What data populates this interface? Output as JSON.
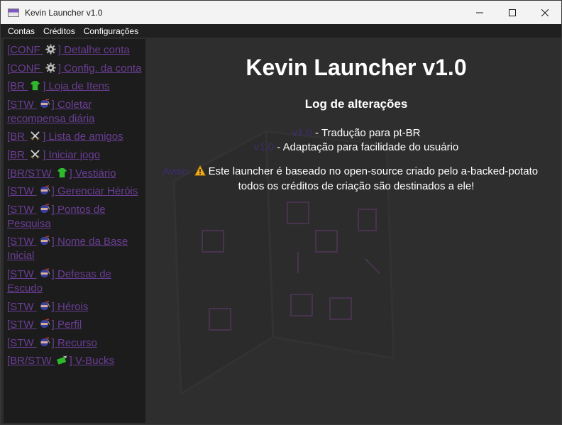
{
  "window": {
    "title": "Kevin Launcher v1.0"
  },
  "menu": {
    "items": [
      "Contas",
      "Créditos",
      "Configurações"
    ]
  },
  "sidebar": {
    "items": [
      {
        "prefix": "[CONF",
        "icon": "gear-icon",
        "label": "] Detalhe conta"
      },
      {
        "prefix": "[CONF",
        "icon": "gear-icon",
        "label": "] Config. da conta"
      },
      {
        "prefix": "[BR",
        "icon": "shirt-icon",
        "label": "] Loja de Itens"
      },
      {
        "prefix": "[STW",
        "icon": "ninja-icon",
        "label": "] Coletar recompensa diária"
      },
      {
        "prefix": "[BR",
        "icon": "crossed-swords-icon",
        "label": "] Lista de amigos"
      },
      {
        "prefix": "[BR",
        "icon": "crossed-swords-icon",
        "label": "] Iniciar jogo"
      },
      {
        "prefix": "[BR/STW",
        "icon": "shirt-icon",
        "label": "] Vestiário"
      },
      {
        "prefix": "[STW",
        "icon": "ninja-icon",
        "label": "] Gerenciar Héróis"
      },
      {
        "prefix": "[STW",
        "icon": "ninja-icon",
        "label": "] Pontos de Pesquisa"
      },
      {
        "prefix": "[STW",
        "icon": "ninja-icon",
        "label": "] Nome da Base Inicial"
      },
      {
        "prefix": "[STW",
        "icon": "ninja-icon",
        "label": "] Defesas de Escudo"
      },
      {
        "prefix": "[STW",
        "icon": "ninja-icon",
        "label": "] Hérois"
      },
      {
        "prefix": "[STW",
        "icon": "ninja-icon",
        "label": "] Perfil"
      },
      {
        "prefix": "[STW",
        "icon": "ninja-icon",
        "label": "] Recurso"
      },
      {
        "prefix": "[BR/STW",
        "icon": "money-icon",
        "label": "] V-Bucks"
      }
    ]
  },
  "main": {
    "title": "Kevin Launcher v1.0",
    "changelog_title": "Log de alterações",
    "changes": [
      {
        "version": "v1.0",
        "text": " - Tradução para pt-BR"
      },
      {
        "version": "v1.0",
        "text": " - Adaptação para facilidade do usuário"
      }
    ],
    "warning": {
      "label": "Aviso",
      "line1": "Este launcher é baseado no open-source criado pelo a-backed-potato",
      "line2": "todos os créditos de criação são destinados a ele!"
    }
  },
  "colors": {
    "link": "#6a3d94",
    "version": "#3f2c6e",
    "background": "#2e2e2e"
  }
}
